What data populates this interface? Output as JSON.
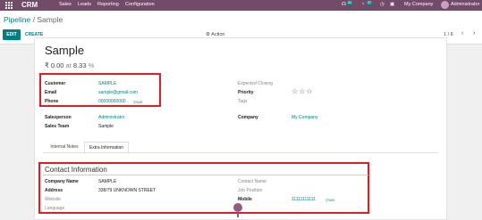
{
  "topnav": {
    "app_name": "CRM",
    "menu": [
      "Sales",
      "Leads",
      "Reporting",
      "Configuration"
    ],
    "chat_badge": "31",
    "activity_badge": "37",
    "company": "My Company",
    "user": "Administrator"
  },
  "breadcrumb": {
    "parent": "Pipeline",
    "separator": "/",
    "current": "Sample"
  },
  "toolbar": {
    "edit_label": "EDIT",
    "create_label": "CREATE",
    "action_label": "Action",
    "pager_text": "1 / 6"
  },
  "record": {
    "title": "Sample",
    "revenue": "₹ 0.00",
    "at_label": "at",
    "probability": "8.33",
    "percent": "%"
  },
  "fields": {
    "customer_label": "Customer",
    "customer_value": "SAMPLE",
    "email_label": "Email",
    "email_value": "sample@gmail.com",
    "phone_label": "Phone",
    "phone_value": "00000000000",
    "sms_label": "SMS",
    "expected_closing_label": "Expected Closing",
    "priority_label": "Priority",
    "tags_label": "Tags",
    "salesperson_label": "Salesperson",
    "salesperson_value": "Administrator",
    "sales_team_label": "Sales Team",
    "sales_team_value": "Sample",
    "company_label": "Company",
    "company_value": "My Company"
  },
  "tabs": [
    "Internal Notes",
    "Extra Information"
  ],
  "contact": {
    "title": "Contact Information",
    "company_name_label": "Company Name",
    "company_name_value": "SAMPLE",
    "address_label": "Address",
    "address_value": "338/79 UNKNOWN STREET",
    "website_label": "Website",
    "language_label": "Language",
    "contact_name_label": "Contact Name",
    "job_position_label": "Job Position",
    "mobile_label": "Mobile",
    "mobile_value": "11111111111",
    "sms_label": "SMS"
  },
  "colors": {
    "nav": "#714b67",
    "accent": "#017e84",
    "highlight": "#e31b23"
  },
  "priority_stars": 0
}
